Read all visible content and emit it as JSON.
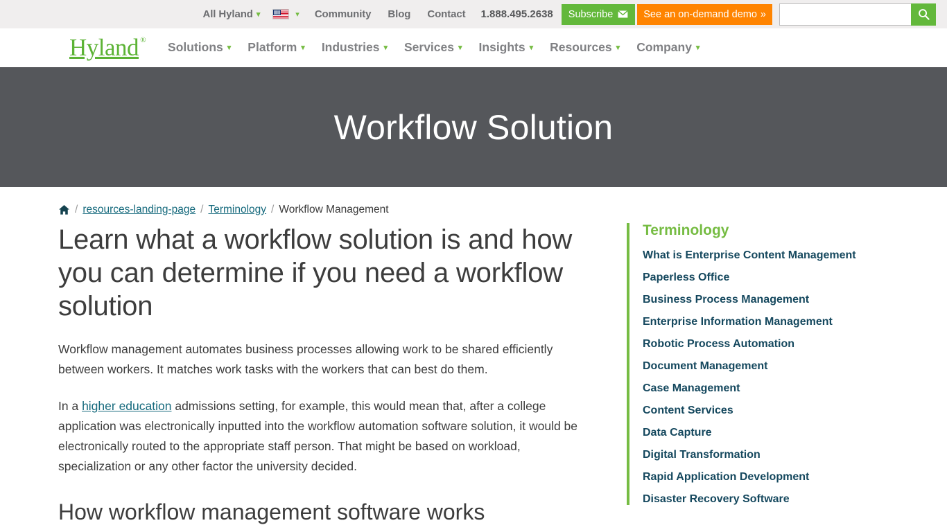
{
  "topbar": {
    "all_hyland": "All Hyland",
    "locale_icon": "us-flag-icon",
    "community": "Community",
    "blog": "Blog",
    "contact": "Contact",
    "phone": "1.888.495.2638",
    "subscribe": "Subscribe",
    "subscribe_icon": "envelope-icon",
    "demo": "See an on-demand demo",
    "demo_icon": "double-chevron-right-icon",
    "search_value": "",
    "search_placeholder": "",
    "search_icon": "search-icon",
    "chevron_icon": "chevron-down-icon"
  },
  "nav": {
    "logo": "Hyland",
    "logo_mark": "®",
    "items": [
      {
        "label": "Solutions"
      },
      {
        "label": "Platform"
      },
      {
        "label": "Industries"
      },
      {
        "label": "Services"
      },
      {
        "label": "Insights"
      },
      {
        "label": "Resources"
      },
      {
        "label": "Company"
      }
    ]
  },
  "hero": {
    "title": "Workflow Solution"
  },
  "breadcrumb": {
    "home_icon": "home-icon",
    "sep": "/",
    "item1": "resources-landing-page",
    "item2": "Terminology",
    "current": "Workflow Management"
  },
  "main": {
    "heading": "Learn what a workflow solution is and how you can determine if you need a workflow solution",
    "para1": "Workflow management automates business processes allowing work to be shared efficiently between workers. It matches work tasks with the workers that can best do them.",
    "para2_before": "In a ",
    "para2_link": "higher education",
    "para2_after": " admissions setting, for example, this would mean that, after a college application was electronically inputted into the workflow automation software solution, it would be electronically routed to the appropriate staff person. That might be based on workload, specialization or any other factor the university decided.",
    "subheading": "How workflow management software works"
  },
  "sidebar": {
    "title": "Terminology",
    "accent_color": "#76bc43",
    "link_color": "#15485e",
    "items": [
      {
        "label": "What is Enterprise Content Management"
      },
      {
        "label": "Paperless Office"
      },
      {
        "label": "Business Process Management"
      },
      {
        "label": "Enterprise Information Management"
      },
      {
        "label": "Robotic Process Automation"
      },
      {
        "label": "Document Management"
      },
      {
        "label": "Case Management"
      },
      {
        "label": "Content Services"
      },
      {
        "label": "Data Capture"
      },
      {
        "label": "Digital Transformation"
      },
      {
        "label": "Rapid Application Development"
      },
      {
        "label": "Disaster Recovery Software"
      }
    ]
  },
  "colors": {
    "brand_green": "#76bc43",
    "orange": "#ff8400",
    "hero_bg": "#55575b",
    "topbar_bg": "#f0eeee",
    "link_teal": "#166a7d"
  }
}
